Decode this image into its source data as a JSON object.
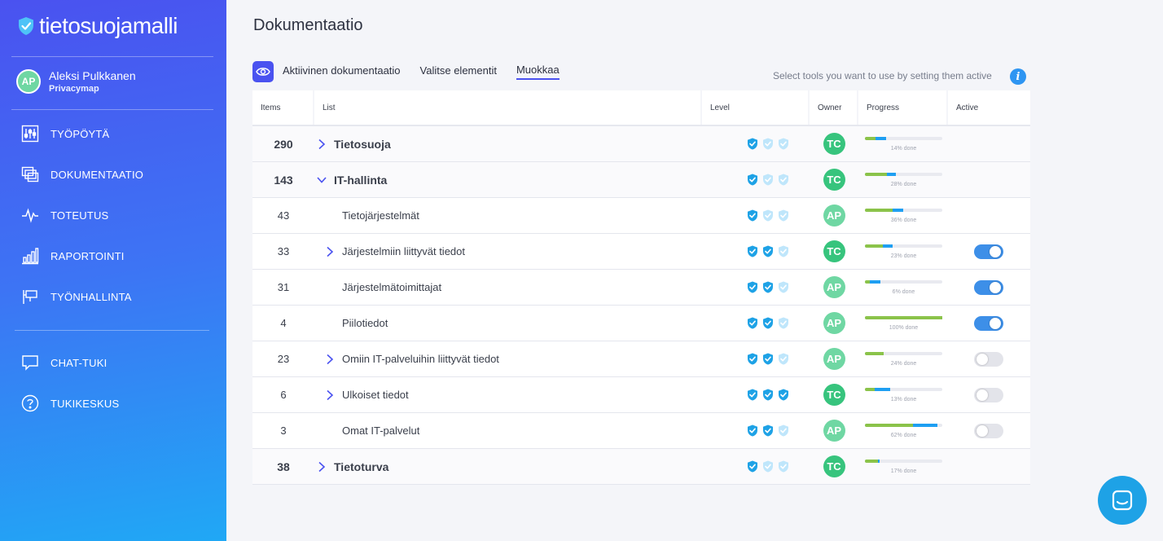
{
  "app": {
    "logo_text": "tietosuojamalli"
  },
  "user": {
    "initials": "AP",
    "name": "Aleksi Pulkkanen",
    "org": "Privacymap"
  },
  "nav": {
    "items": [
      {
        "label": "TYÖPÖYTÄ",
        "icon": "sliders-icon"
      },
      {
        "label": "DOKUMENTAATIO",
        "icon": "documents-icon"
      },
      {
        "label": "TOTEUTUS",
        "icon": "pulse-icon"
      },
      {
        "label": "RAPORTOINTI",
        "icon": "bar-chart-icon"
      },
      {
        "label": "TYÖNHALLINTA",
        "icon": "flag-icon"
      }
    ],
    "support": [
      {
        "label": "CHAT-TUKI",
        "icon": "chat-icon"
      },
      {
        "label": "TUKIKESKUS",
        "icon": "help-icon"
      }
    ]
  },
  "page": {
    "title": "Dokumentaatio"
  },
  "toolbar": {
    "tabs": [
      "Aktiivinen dokumentaatio",
      "Valitse elementit",
      "Muokkaa"
    ],
    "active_tab": 2,
    "hint": "Select tools you want to use by setting them active"
  },
  "table": {
    "headers": {
      "items": "Items",
      "list": "List",
      "level": "Level",
      "owner": "Owner",
      "progress": "Progress",
      "active": "Active"
    },
    "rows": [
      {
        "items": "290",
        "name": "Tietosuoja",
        "top": true,
        "chevron": "right",
        "level": 1,
        "owner": "TC",
        "green": 0.14,
        "blue": 0.14,
        "pct": "14% done",
        "active": null
      },
      {
        "items": "143",
        "name": "IT-hallinta",
        "top": true,
        "chevron": "down",
        "level": 1,
        "owner": "TC",
        "green": 0.28,
        "blue": 0.12,
        "pct": "28% done",
        "active": null
      },
      {
        "items": "43",
        "name": "Tietojärjestelmät",
        "top": false,
        "chevron": null,
        "level": 1,
        "owner": "AP",
        "green": 0.36,
        "blue": 0.14,
        "pct": "36% done",
        "active": null
      },
      {
        "items": "33",
        "name": "Järjestelmiin liittyvät tiedot",
        "top": false,
        "chevron": "right",
        "level": 2,
        "owner": "TC",
        "green": 0.23,
        "blue": 0.13,
        "pct": "23% done",
        "active": true
      },
      {
        "items": "31",
        "name": "Järjestelmätoimittajat",
        "top": false,
        "chevron": null,
        "level": 2,
        "owner": "AP",
        "green": 0.06,
        "blue": 0.14,
        "pct": "6% done",
        "active": true
      },
      {
        "items": "4",
        "name": "Piilotiedot",
        "top": false,
        "chevron": null,
        "level": 2,
        "owner": "AP",
        "green": 1.0,
        "blue": 0.0,
        "pct": "100% done",
        "active": true
      },
      {
        "items": "23",
        "name": "Omiin IT-palveluihin liittyvät tiedot",
        "top": false,
        "chevron": "right",
        "level": 2,
        "owner": "AP",
        "green": 0.24,
        "blue": 0.0,
        "pct": "24% done",
        "active": false
      },
      {
        "items": "6",
        "name": "Ulkoiset tiedot",
        "top": false,
        "chevron": "right",
        "level": 3,
        "owner": "TC",
        "green": 0.13,
        "blue": 0.2,
        "pct": "13% done",
        "active": false
      },
      {
        "items": "3",
        "name": "Omat IT-palvelut",
        "top": false,
        "chevron": null,
        "level": 2,
        "owner": "AP",
        "green": 0.62,
        "blue": 0.32,
        "pct": "62% done",
        "active": false
      },
      {
        "items": "38",
        "name": "Tietoturva",
        "top": true,
        "chevron": "right",
        "level": 1,
        "owner": "TC",
        "green": 0.17,
        "blue": 0.02,
        "pct": "17% done",
        "active": null
      }
    ]
  },
  "colors": {
    "accent": "#4a52f0",
    "green": "#8bc34a",
    "blue": "#1e9ff2",
    "toggle_on": "#3d8fe8"
  }
}
